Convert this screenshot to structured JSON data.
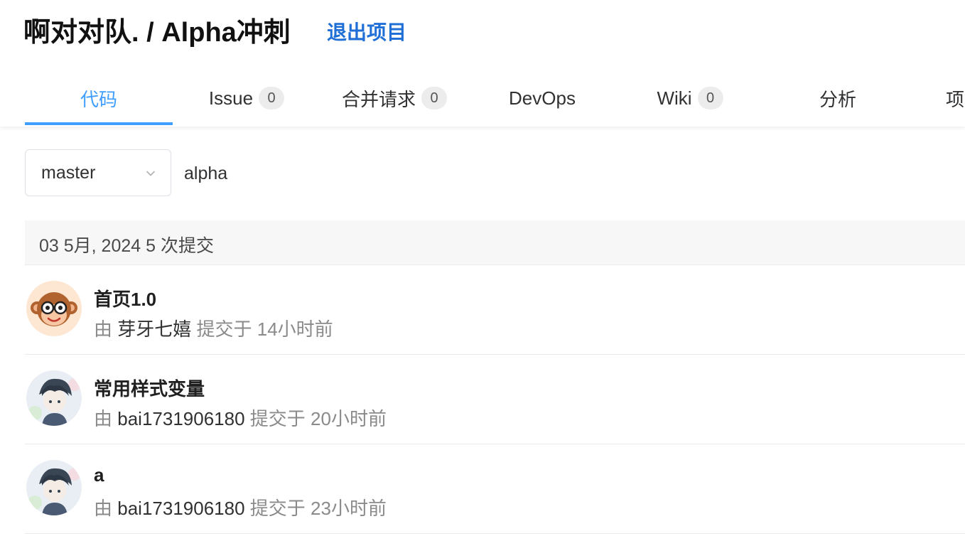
{
  "header": {
    "project_title": "啊对对队. / Alpha冲刺",
    "exit_label": "退出项目"
  },
  "tabs": [
    {
      "label": "代码",
      "active": true
    },
    {
      "label": "Issue",
      "count": "0"
    },
    {
      "label": "合并请求",
      "count": "0"
    },
    {
      "label": "DevOps"
    },
    {
      "label": "Wiki",
      "count": "0"
    },
    {
      "label": "分析"
    },
    {
      "label": "项"
    }
  ],
  "branch": {
    "selected": "master",
    "repo_name": "alpha"
  },
  "commit_group": {
    "header": "03 5月, 2024 5 次提交"
  },
  "commits": [
    {
      "message": "首页1.0",
      "by": "由",
      "author": "芽牙七嬉",
      "action": "提交于",
      "time": "14小时前",
      "avatar": "monkey-avatar"
    },
    {
      "message": "常用样式变量",
      "by": "由",
      "author": "bai1731906180",
      "action": "提交于",
      "time": "20小时前",
      "avatar": "anime-avatar"
    },
    {
      "message": "a",
      "by": "由",
      "author": "bai1731906180",
      "action": "提交于",
      "time": "23小时前",
      "avatar": "anime-avatar"
    }
  ],
  "colors": {
    "accent": "#409eff",
    "link": "#1f6fd6",
    "muted": "#8a8a8a"
  }
}
